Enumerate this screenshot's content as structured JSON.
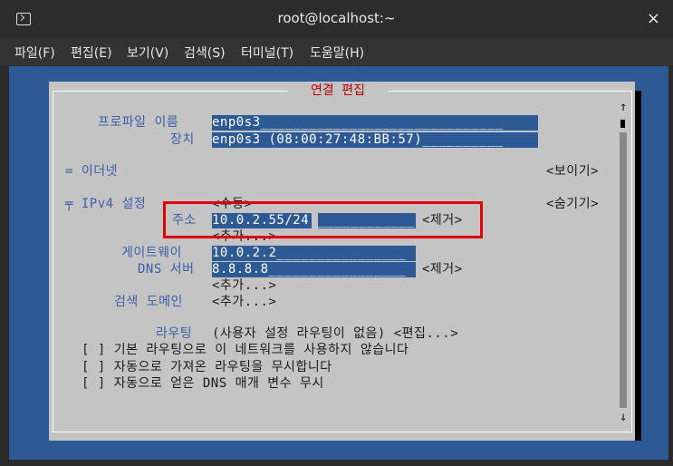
{
  "window": {
    "title": "root@localhost:~",
    "close": "×"
  },
  "menu": [
    "파일(F)",
    "편집(E)",
    "보기(V)",
    "검색(S)",
    "터미널(T)",
    "도움말(H)"
  ],
  "dialog": {
    "title": "연결 편집",
    "profile_label": "프로파일 이름",
    "profile_value": "enp0s3______________________________",
    "device_label": "장치",
    "device_value": "enp0s3 (08:00:27:48:BB:57)__________",
    "ethernet": {
      "label": "= 이더넷",
      "action": "<보이기>"
    },
    "ipv4": {
      "label": "╤ IPv4 설정",
      "mode": "<수동>",
      "action": "<숨기기>",
      "address_label": "주소",
      "address_value": "10.0.2.55/24",
      "address_blank": "____________",
      "address_remove": "<제거>",
      "address_add": "<추가...>",
      "gateway_label": "게이트웨이",
      "gateway_value": "10.0.2.2________________",
      "dns_label": "DNS 서버",
      "dns_value": "8.8.8.8_________________",
      "dns_remove": "<제거>",
      "dns_add": "<추가...>",
      "search_label": "검색 도메인",
      "search_add": "<추가...>",
      "routing_label": "라우팅",
      "routing_value": "(사용자 설정 라우팅이 없음) <편집...>",
      "opt1": "[ ] 기본 라우팅으로 이 네트워크를 사용하지 않습니다",
      "opt2": "[ ] 자동으로 가져온 라우팅을 무시합니다",
      "opt3": "[ ] 자동으로 얻은 DNS 매개 변수 무시"
    },
    "scroll_up": "↑",
    "scroll_down": "↓"
  }
}
